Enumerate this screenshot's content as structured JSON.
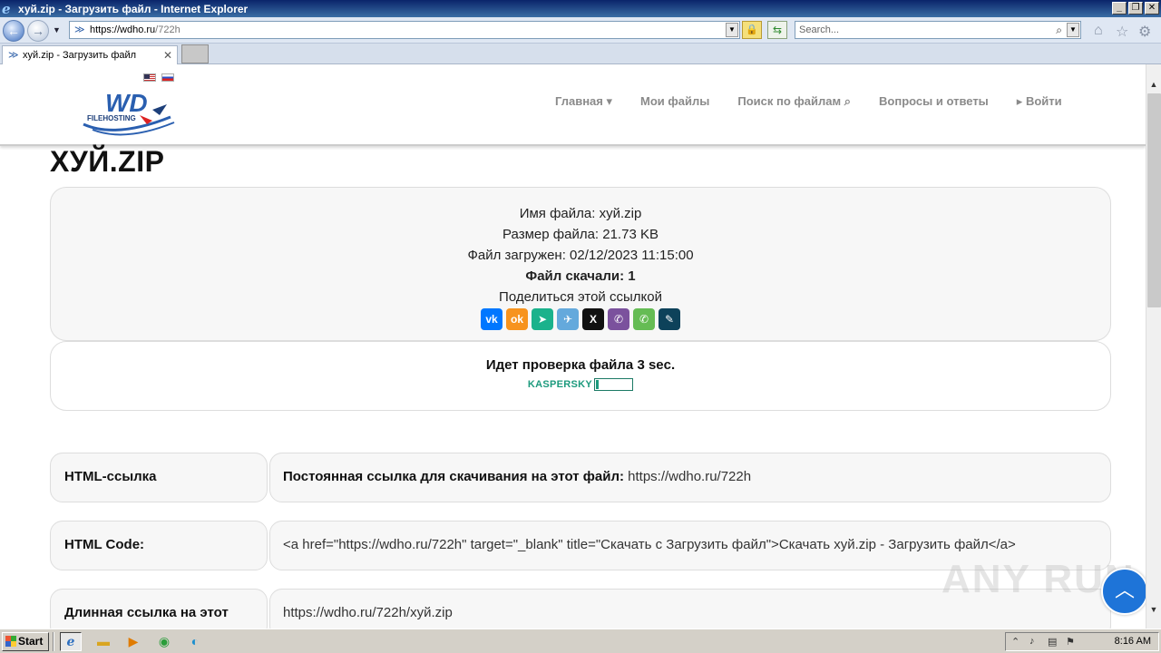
{
  "browser": {
    "window_title": "хуй.zip - Загрузить файл - Internet Explorer",
    "address_host": "https://wdho.ru",
    "address_path": "/722h",
    "search_placeholder": "Search...",
    "tab_title": "хуй.zip - Загрузить файл"
  },
  "site": {
    "logo_text": "WD",
    "logo_subtext": "FILEHOSTING",
    "nav": [
      {
        "label": "Главная",
        "icon": "caret-down"
      },
      {
        "label": "Мои файлы"
      },
      {
        "label": "Поиск по файлам",
        "icon": "search-icon"
      },
      {
        "label": "Вопросы и ответы"
      },
      {
        "label": "Войти",
        "icon": "caret-right"
      }
    ]
  },
  "file": {
    "heading": "ХУЙ.ZIP",
    "name_line": "Имя файла: хуй.zip",
    "size_line": "Размер файла: 21.73 KB",
    "uploaded_line": "Файл загружен: 02/12/2023 11:15:00",
    "downloads_line": "Файл скачали: 1",
    "share_label": "Поделиться этой ссылкой",
    "share_buttons": [
      {
        "name": "vk",
        "glyph": "vk",
        "color": "#0077ff"
      },
      {
        "name": "odnoklassniki",
        "glyph": "ok",
        "color": "#f7931e"
      },
      {
        "name": "mail",
        "glyph": "➤",
        "color": "#1bb28c"
      },
      {
        "name": "telegram",
        "glyph": "✈",
        "color": "#64a9dc"
      },
      {
        "name": "x",
        "glyph": "X",
        "color": "#111111"
      },
      {
        "name": "viber",
        "glyph": "✆",
        "color": "#7b519d"
      },
      {
        "name": "whatsapp",
        "glyph": "✆",
        "color": "#65bc54"
      },
      {
        "name": "livejournal",
        "glyph": "✎",
        "color": "#0d425a"
      }
    ]
  },
  "check": {
    "text": "Идет проверка файла 3 sec.",
    "av_name": "KASPERSKY",
    "progress": 0.08
  },
  "rows": [
    {
      "label": "HTML-ссылка",
      "value_strong": "Постоянная ссылка для скачивания на этот файл: ",
      "value": "https://wdho.ru/722h"
    },
    {
      "label": "HTML Code:",
      "value_strong": "",
      "value": "<a href=\"https://wdho.ru/722h\" target=\"_blank\" title=\"Скачать с Загрузить файл\">Скачать хуй.zip - Загрузить файл</a>"
    },
    {
      "label": "Длинная ссылка на этот",
      "value_strong": "",
      "value": "https://wdho.ru/722h/хуй.zip"
    }
  ],
  "watermark": "ANY RUN",
  "taskbar": {
    "start_label": "Start",
    "clock": "8:16 AM"
  },
  "colors": {
    "accent": "#1e74d8",
    "nav_text": "#8a8a8a",
    "kaspersky": "#1c9a7d"
  }
}
